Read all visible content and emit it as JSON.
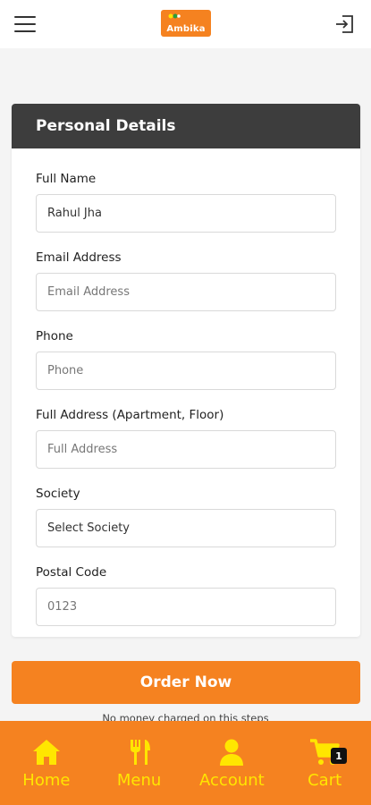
{
  "header": {
    "menu_icon": "hamburger-icon",
    "logo_text": "Ambika",
    "logout_icon": "logout-icon"
  },
  "form_card": {
    "title": "Personal Details",
    "fields": [
      {
        "label": "Full Name",
        "value": "Rahul Jha",
        "placeholder": "Full Name"
      },
      {
        "label": "Email Address",
        "value": "",
        "placeholder": "Email Address"
      },
      {
        "label": "Phone",
        "value": "",
        "placeholder": "Phone"
      },
      {
        "label": "Full Address (Apartment, Floor)",
        "value": "",
        "placeholder": "Full Address"
      },
      {
        "label": "Society",
        "selected": "Select Society"
      },
      {
        "label": "Postal Code",
        "value": "",
        "placeholder": "0123"
      }
    ]
  },
  "order": {
    "button_label": "Order Now",
    "note": "No money charged on this steps"
  },
  "bottom_nav": {
    "items": [
      {
        "label": "Home",
        "icon": "home-icon"
      },
      {
        "label": "Menu",
        "icon": "fork-knife-icon"
      },
      {
        "label": "Account",
        "icon": "user-icon"
      },
      {
        "label": "Cart",
        "icon": "cart-icon"
      }
    ],
    "cart_count": "1"
  },
  "colors": {
    "accent": "#f58220",
    "nav_text": "#ffe600",
    "card_header": "#3d3d3d"
  }
}
